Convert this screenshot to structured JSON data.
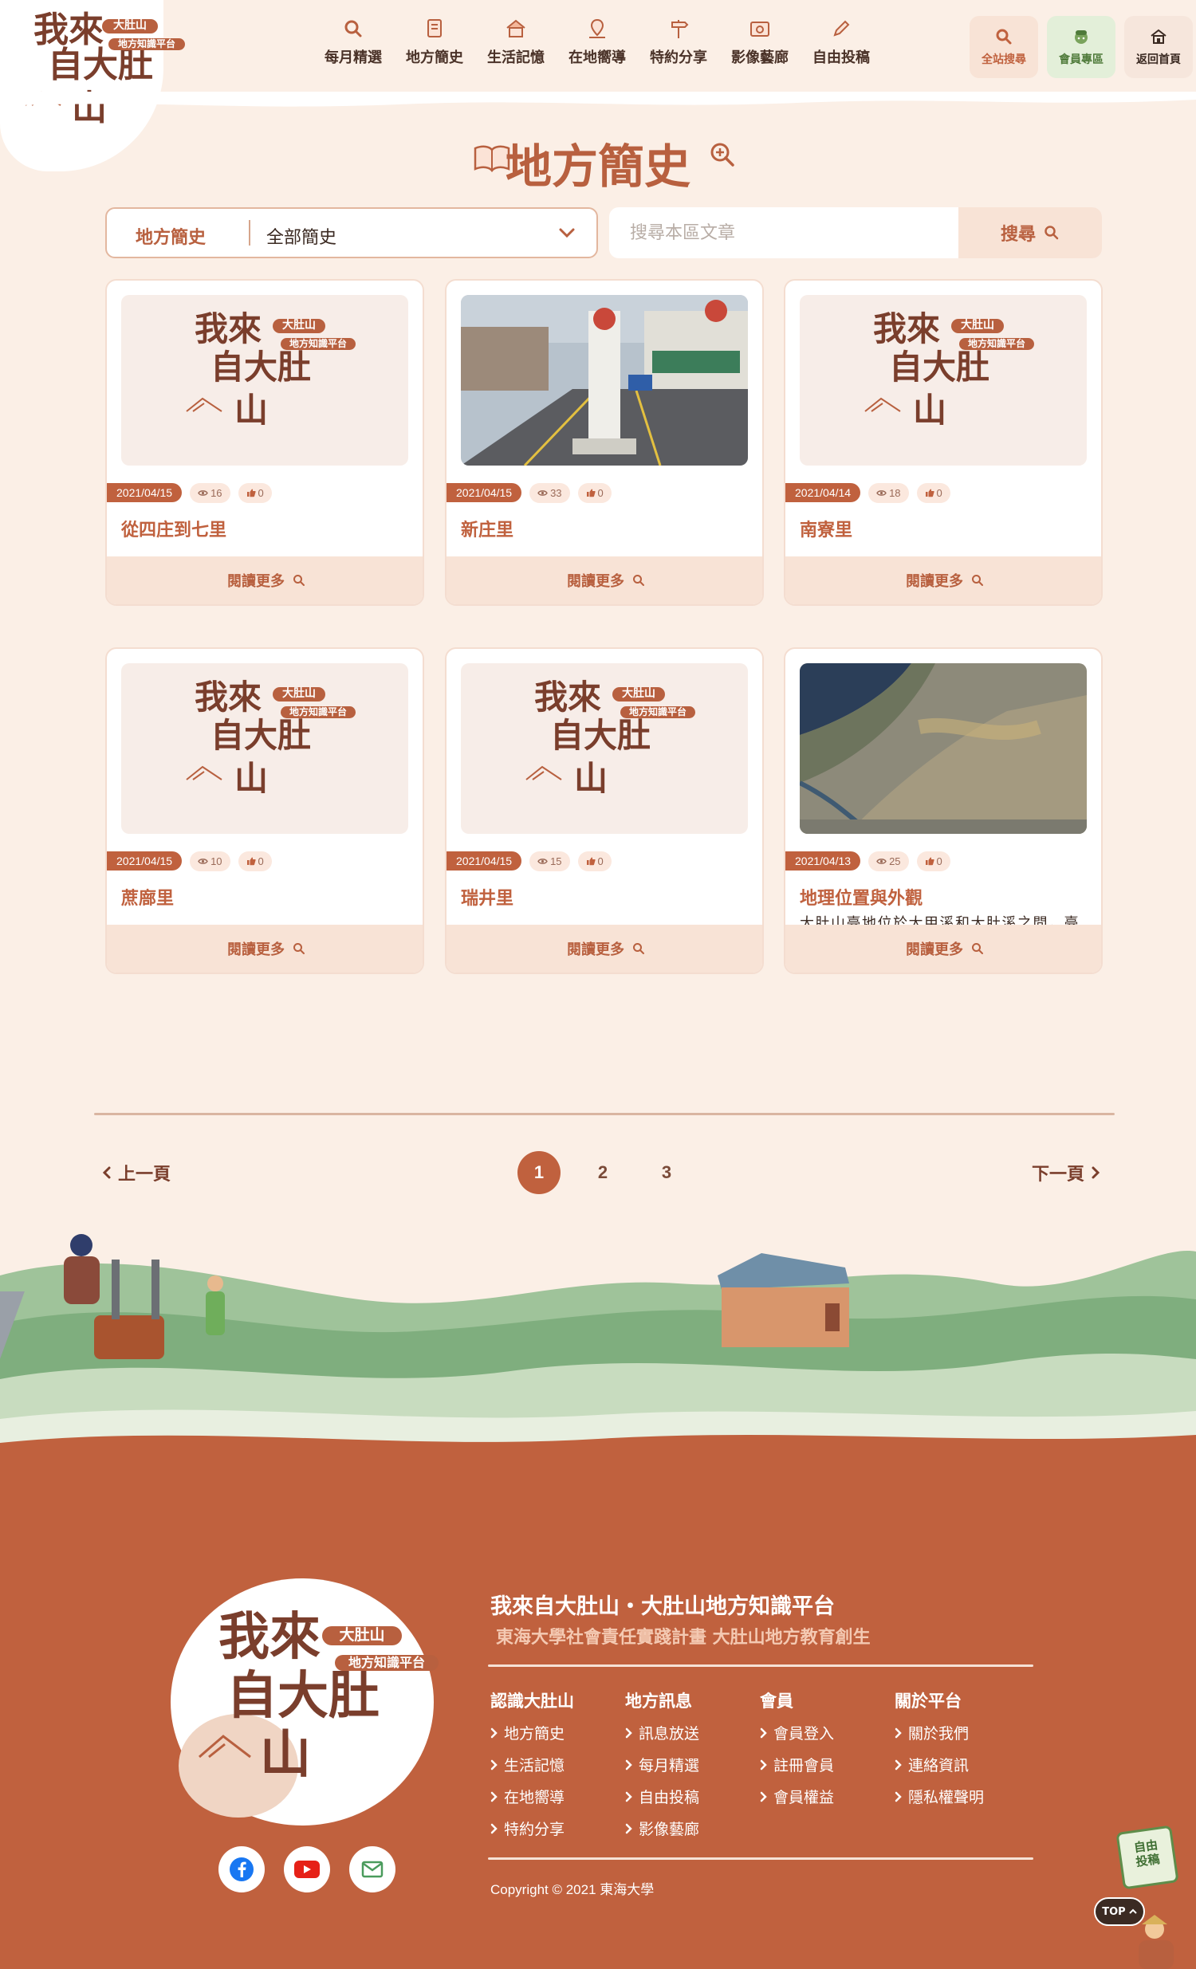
{
  "header": {
    "logo": {
      "line1": "我來",
      "line2": "自大肚",
      "line3": "山",
      "tag1": "大肚山",
      "tag2": "地方知識平台"
    },
    "nav": [
      {
        "label": "每月精選",
        "icon": "search-icon"
      },
      {
        "label": "地方簡史",
        "icon": "book-icon"
      },
      {
        "label": "生活記憶",
        "icon": "house-icon"
      },
      {
        "label": "在地嚮導",
        "icon": "map-pin-icon"
      },
      {
        "label": "特約分享",
        "icon": "signpost-icon"
      },
      {
        "label": "影像藝廊",
        "icon": "photo-icon"
      },
      {
        "label": "自由投稿",
        "icon": "pencil-icon"
      }
    ],
    "actions": [
      {
        "label": "全站搜尋",
        "icon": "search-icon",
        "color": "#c0613e",
        "bg": "#f8e3d6"
      },
      {
        "label": "會員專區",
        "icon": "member-icon",
        "color": "#4f7a3a",
        "bg": "#e3efd9"
      },
      {
        "label": "返回首頁",
        "icon": "home-icon",
        "color": "#3b2a22",
        "bg": "#f6e6dc"
      }
    ]
  },
  "page": {
    "title": "地方簡史"
  },
  "filter": {
    "label": "地方簡史",
    "value": "全部簡史"
  },
  "search": {
    "placeholder": "搜尋本區文章",
    "button": "搜尋"
  },
  "cards": [
    {
      "date": "2021/04/15",
      "views": "16",
      "likes": "0",
      "title": "從四庄到七里",
      "excerpt": "",
      "image": "logo",
      "more": "閱讀更多"
    },
    {
      "date": "2021/04/15",
      "views": "33",
      "likes": "0",
      "title": "新庄里",
      "excerpt": "",
      "image": "street",
      "more": "閱讀更多"
    },
    {
      "date": "2021/04/14",
      "views": "18",
      "likes": "0",
      "title": "南寮里",
      "excerpt": "",
      "image": "logo",
      "more": "閱讀更多"
    },
    {
      "date": "2021/04/15",
      "views": "10",
      "likes": "0",
      "title": "蔗廍里",
      "excerpt": "",
      "image": "logo",
      "more": "閱讀更多"
    },
    {
      "date": "2021/04/15",
      "views": "15",
      "likes": "0",
      "title": "瑞井里",
      "excerpt": "",
      "image": "logo",
      "more": "閱讀更多"
    },
    {
      "date": "2021/04/13",
      "views": "25",
      "likes": "0",
      "title": "地理位置與外觀",
      "excerpt": "大肚山臺地位於大甲溪和大肚溪之間，臺中盆地以西、清水海岸平原以東。是大安溪、大甲溪與大肚溪的聯合沖…",
      "image": "aerial",
      "more": "閱讀更多"
    }
  ],
  "pagination": {
    "prev": "上一頁",
    "next": "下一頁",
    "pages": [
      "1",
      "2",
      "3"
    ],
    "current": "1"
  },
  "footer": {
    "title": "我來自大肚山・大肚山地方知識平台",
    "subtitle": "東海大學社會責任實踐計畫  大肚山地方教育創生",
    "columns": [
      {
        "heading": "認識大肚山",
        "links": [
          "地方簡史",
          "生活記憶",
          "在地嚮導",
          "特約分享"
        ]
      },
      {
        "heading": "地方訊息",
        "links": [
          "訊息放送",
          "每月精選",
          "自由投稿",
          "影像藝廊"
        ]
      },
      {
        "heading": "會員",
        "links": [
          "會員登入",
          "註冊會員",
          "會員權益"
        ]
      },
      {
        "heading": "關於平台",
        "links": [
          "關於我們",
          "連絡資訊",
          "隱私權聲明"
        ]
      }
    ],
    "copyright": "Copyright © 2021 東海大學",
    "social": [
      "facebook-icon",
      "youtube-icon",
      "mail-icon"
    ]
  },
  "floating": {
    "submit": "自由投稿",
    "top": "TOP"
  }
}
